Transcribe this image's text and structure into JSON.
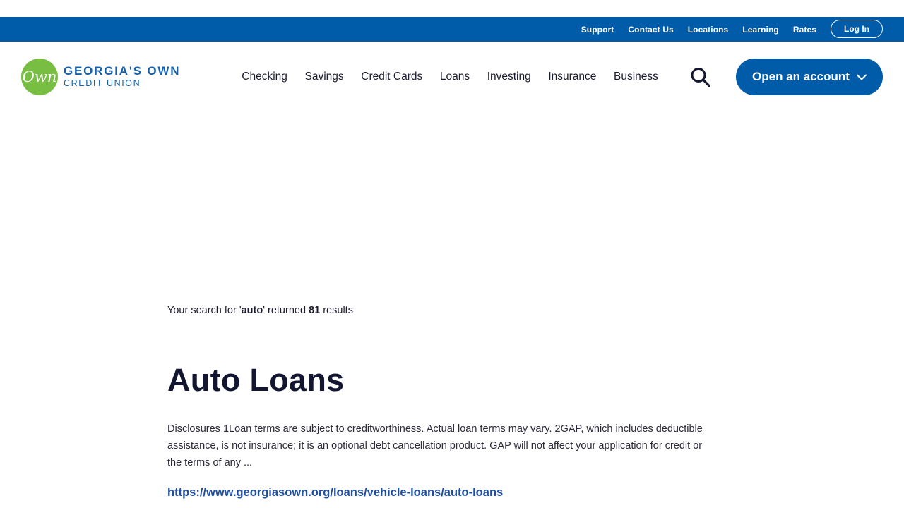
{
  "utility_nav": {
    "links": [
      "Support",
      "Contact Us",
      "Locations",
      "Learning",
      "Rates"
    ],
    "login_label": "Log In"
  },
  "logo": {
    "mark": "Own",
    "line1": "GEORGIA'S OWN",
    "line2": "CREDIT UNION"
  },
  "main_nav": {
    "items": [
      "Checking",
      "Savings",
      "Credit Cards",
      "Loans",
      "Investing",
      "Insurance",
      "Business"
    ],
    "search_icon": "search-icon",
    "cta_label": "Open an account",
    "cta_icon": "chevron-down-icon"
  },
  "search": {
    "prefix": "Your search for '",
    "query": "auto",
    "middle": "' returned ",
    "count": "81",
    "suffix": " results"
  },
  "results": [
    {
      "title": "Auto Loans",
      "snippet": "Disclosures 1Loan terms are subject to creditworthiness. Actual loan terms may vary. 2GAP, which includes deductible assistance, is not insurance; it is an optional debt cancellation product. GAP will not affect your application for credit or the terms of any ...",
      "url": "https://www.georgiasown.org/loans/vehicle-loans/auto-loans"
    }
  ],
  "colors": {
    "brand_blue": "#005ca9",
    "logo_green": "#78be43",
    "link_blue": "#1f4fa3"
  }
}
